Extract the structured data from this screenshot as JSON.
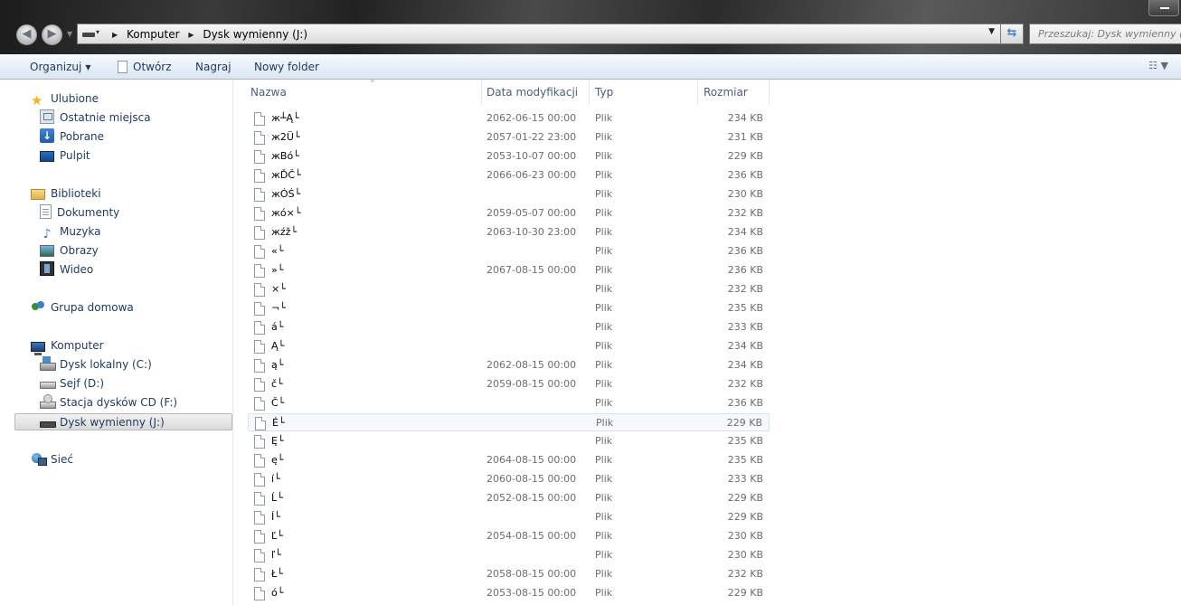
{
  "address": {
    "crumbs": [
      "Komputer",
      "Dysk wymienny (J:)"
    ],
    "search_placeholder": "Przeszukaj: Dysk wymienny (J:)"
  },
  "toolbar": {
    "organize": "Organizuj",
    "open": "Otwórz",
    "burn": "Nagraj",
    "new_folder": "Nowy folder"
  },
  "nav": {
    "favorites": "Ulubione",
    "recent": "Ostatnie miejsca",
    "downloads": "Pobrane",
    "desktop": "Pulpit",
    "libraries": "Biblioteki",
    "documents": "Dokumenty",
    "music": "Muzyka",
    "pictures": "Obrazy",
    "videos": "Wideo",
    "homegroup": "Grupa domowa",
    "computer": "Komputer",
    "drive_c": "Dysk lokalny (C:)",
    "drive_d": "Sejf (D:)",
    "drive_f": "Stacja dysków CD (F:)",
    "drive_j": "Dysk wymienny (J:)",
    "network": "Sieć"
  },
  "columns": {
    "name": "Nazwa",
    "date": "Data modyfikacji",
    "type": "Typ",
    "size": "Rozmiar"
  },
  "files": [
    {
      "name": "ж┴Ą└",
      "date": "2062-06-15 00:00",
      "type": "Plik",
      "size": "234 KB"
    },
    {
      "name": "ж2Ü└",
      "date": "2057-01-22 23:00",
      "type": "Plik",
      "size": "231 KB"
    },
    {
      "name": "жBó└",
      "date": "2053-10-07 00:00",
      "type": "Plik",
      "size": "229 KB"
    },
    {
      "name": "жĎČ└",
      "date": "2066-06-23 00:00",
      "type": "Plik",
      "size": "236 KB"
    },
    {
      "name": "жÓŚ└",
      "date": "",
      "type": "Plik",
      "size": "230 KB"
    },
    {
      "name": "жó×└",
      "date": "2059-05-07 00:00",
      "type": "Plik",
      "size": "232 KB"
    },
    {
      "name": "жźž└",
      "date": "2063-10-30 23:00",
      "type": "Plik",
      "size": "234 KB"
    },
    {
      "name": "«└",
      "date": "",
      "type": "Plik",
      "size": "236 KB"
    },
    {
      "name": "»└",
      "date": "2067-08-15 00:00",
      "type": "Plik",
      "size": "236 KB"
    },
    {
      "name": "×└",
      "date": "",
      "type": "Plik",
      "size": "232 KB"
    },
    {
      "name": "¬└",
      "date": "",
      "type": "Plik",
      "size": "235 KB"
    },
    {
      "name": "á└",
      "date": "",
      "type": "Plik",
      "size": "233 KB"
    },
    {
      "name": "Ą└",
      "date": "",
      "type": "Plik",
      "size": "234 KB"
    },
    {
      "name": "ą└",
      "date": "2062-08-15 00:00",
      "type": "Plik",
      "size": "234 KB"
    },
    {
      "name": "č└",
      "date": "2059-08-15 00:00",
      "type": "Plik",
      "size": "232 KB"
    },
    {
      "name": "Č└",
      "date": "",
      "type": "Plik",
      "size": "236 KB"
    },
    {
      "name": "É└",
      "date": "",
      "type": "Plik",
      "size": "229 KB"
    },
    {
      "name": "Ę└",
      "date": "",
      "type": "Plik",
      "size": "235 KB"
    },
    {
      "name": "ę└",
      "date": "2064-08-15 00:00",
      "type": "Plik",
      "size": "235 KB"
    },
    {
      "name": "í└",
      "date": "2060-08-15 00:00",
      "type": "Plik",
      "size": "233 KB"
    },
    {
      "name": "Ĺ└",
      "date": "2052-08-15 00:00",
      "type": "Plik",
      "size": "229 KB"
    },
    {
      "name": "Í└",
      "date": "",
      "type": "Plik",
      "size": "229 KB"
    },
    {
      "name": "Ľ└",
      "date": "2054-08-15 00:00",
      "type": "Plik",
      "size": "230 KB"
    },
    {
      "name": "ľ└",
      "date": "",
      "type": "Plik",
      "size": "230 KB"
    },
    {
      "name": "Ł└",
      "date": "2058-08-15 00:00",
      "type": "Plik",
      "size": "232 KB"
    },
    {
      "name": "ó└",
      "date": "2053-08-15 00:00",
      "type": "Plik",
      "size": "229 KB"
    }
  ],
  "colors": {
    "toolbar_bg": "#e7eef7",
    "text": "#1e395b",
    "accent": "#3f7fc9"
  }
}
